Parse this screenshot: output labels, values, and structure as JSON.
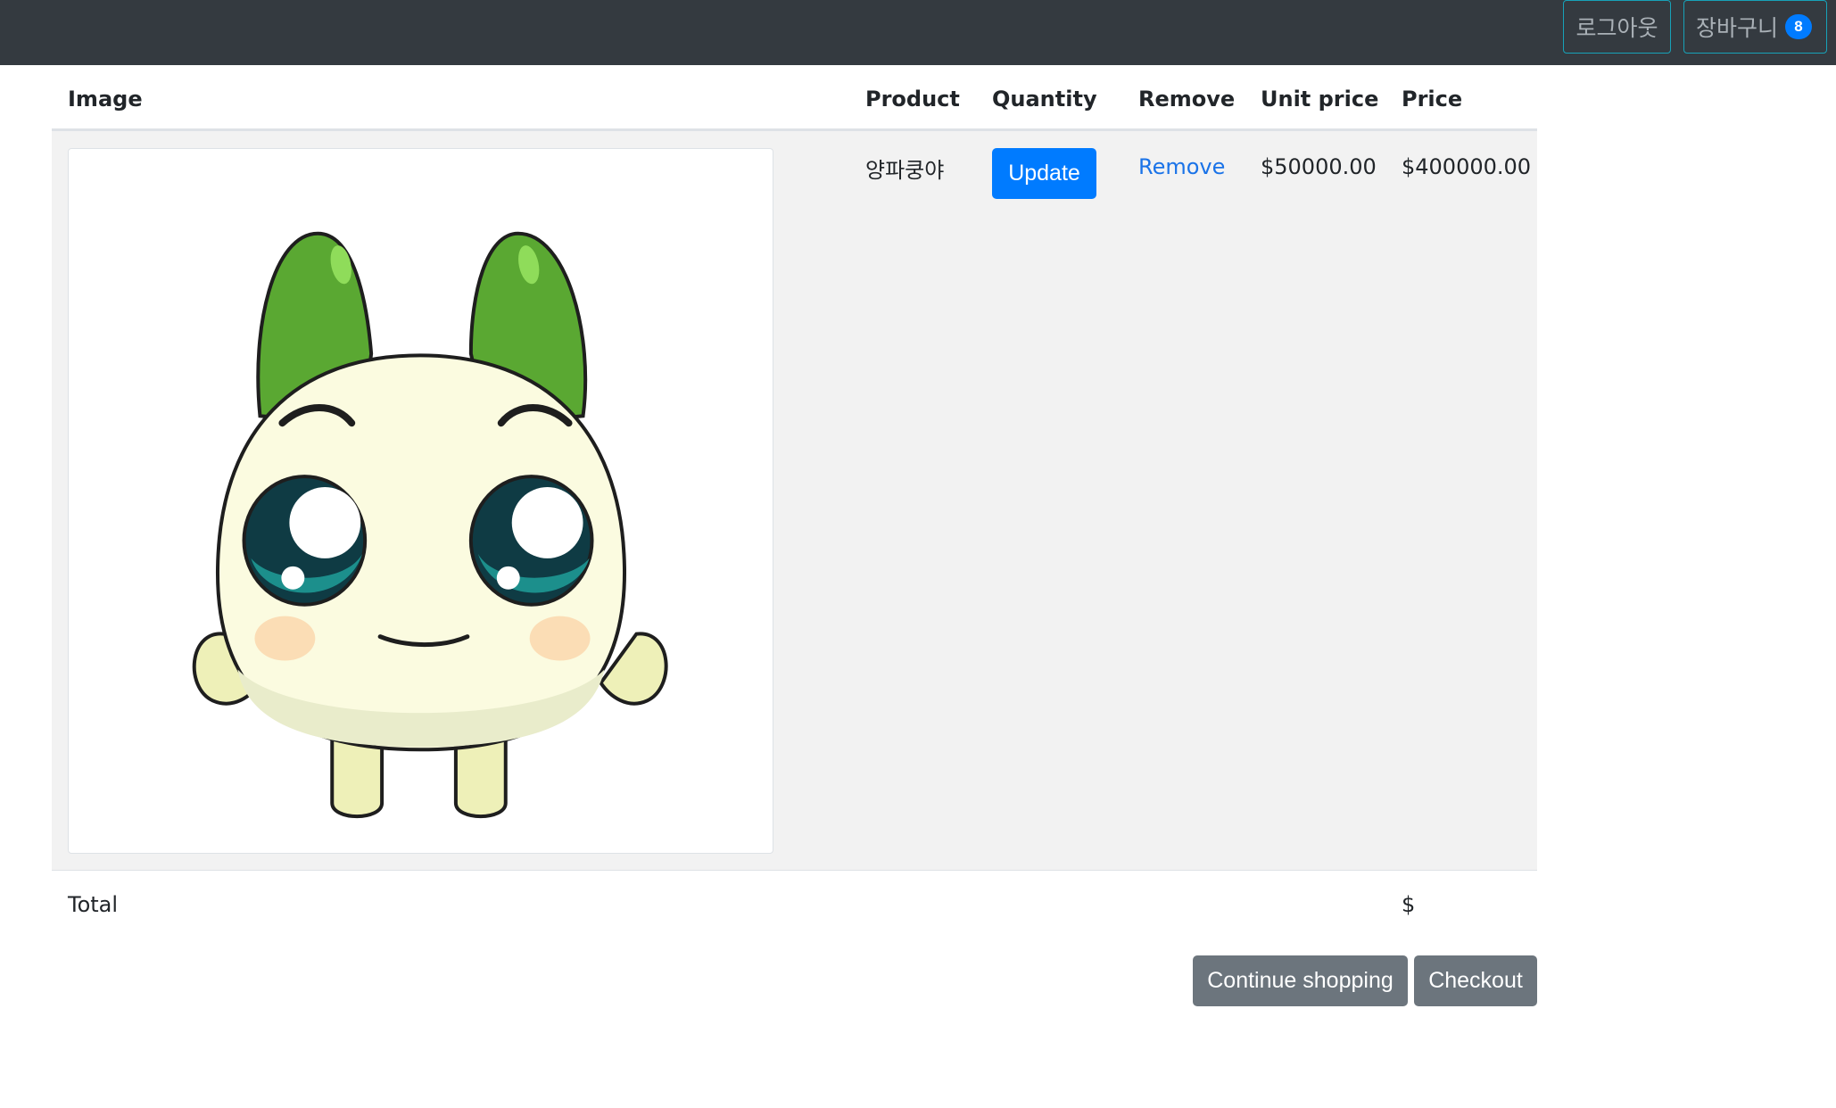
{
  "navbar": {
    "logout_label": "로그아웃",
    "cart_label": "장바구니",
    "cart_count": "8"
  },
  "table": {
    "headers": {
      "image": "Image",
      "product": "Product",
      "quantity": "Quantity",
      "remove": "Remove",
      "unit_price": "Unit price",
      "price": "Price"
    },
    "items": [
      {
        "product": "양파쿵야",
        "update_label": "Update",
        "remove_label": "Remove",
        "unit_price": "$50000.00",
        "price": "$400000.00"
      }
    ],
    "total_label": "Total",
    "total_value": "$"
  },
  "actions": {
    "continue_label": "Continue shopping",
    "checkout_label": "Checkout"
  },
  "colors": {
    "navbar_bg": "#343a40",
    "primary": "#007bff",
    "secondary": "#6c757d",
    "outline_info": "#17a2b8",
    "row_bg": "#f2f2f2"
  }
}
